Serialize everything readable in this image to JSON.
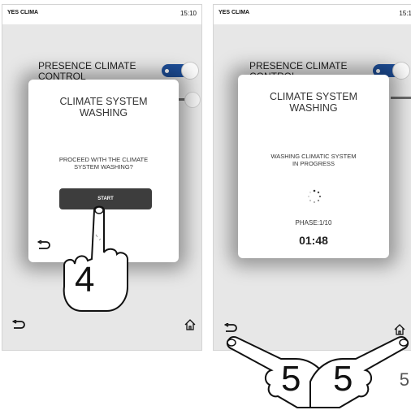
{
  "app_title": "YES CLIMA",
  "left_screen": {
    "clock": "15:10",
    "background_setting": "PRESENCE CLIMATE\nCONTROL",
    "dialog": {
      "title": "CLIMATE SYSTEM\nWASHING",
      "message": "PROCEED WITH THE CLIMATE\nSYSTEM WASHING?",
      "start_label": "START"
    },
    "step_label": "4"
  },
  "right_screen": {
    "clock": "15:1",
    "background_setting": "PRESENCE CLIMATE\nCONTROL",
    "dialog": {
      "title": "CLIMATE SYSTEM\nWASHING",
      "status": "WASHING CLIMATIC SYSTEM\nIN PROGRESS",
      "phase": "PHASE:1/10",
      "timer": "01:48"
    },
    "step_labels": [
      "5",
      "5"
    ]
  },
  "page_number": "5",
  "colors": {
    "toggle_on": "#1e4f9a",
    "button_dark": "#3d3d3d",
    "screen_bg": "#e7e7e7"
  },
  "icons": [
    "back-arrow-icon",
    "home-icon",
    "loading-spinner-icon",
    "hand-pointer-icon"
  ]
}
